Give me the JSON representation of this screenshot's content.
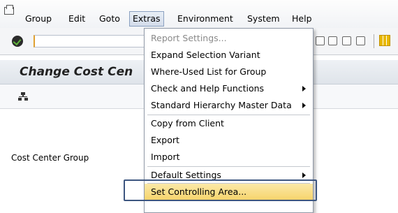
{
  "menubar": {
    "items": [
      "Group",
      "Edit",
      "Goto",
      "Extras",
      "Environment",
      "System",
      "Help"
    ],
    "active": "Extras"
  },
  "toolbar": {
    "command_field_value": ""
  },
  "title": {
    "text": "Change Cost Cen"
  },
  "form": {
    "label": "Cost Center Group"
  },
  "extras_menu": {
    "items": [
      {
        "label": "Report Settings...",
        "disabled": true
      },
      {
        "label": "Expand Selection Variant"
      },
      {
        "label": "Where-Used List for Group"
      },
      {
        "label": "Check and Help Functions",
        "submenu": true
      },
      {
        "label": "Standard Hierarchy Master Data",
        "submenu": true
      },
      {
        "label": "Copy from Client"
      },
      {
        "label": "Export"
      },
      {
        "label": "Import"
      },
      {
        "label": "Default Settings",
        "submenu": true
      },
      {
        "label": "Set Controlling Area..."
      }
    ],
    "highlighted": "Set Controlling Area..."
  },
  "colors": {
    "highlight": "#f6d36a",
    "callout_border": "#3d5680"
  }
}
